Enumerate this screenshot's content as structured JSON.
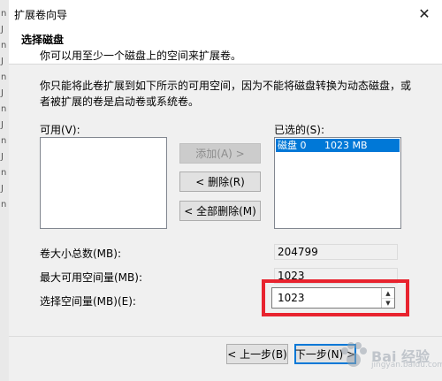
{
  "window": {
    "title": "扩展卷向导",
    "close_glyph": "✕"
  },
  "header": {
    "title": "选择磁盘",
    "subtitle": "你可以用至少一个磁盘上的空间来扩展卷。"
  },
  "description": "你只能将此卷扩展到如下所示的可用空间，因为不能将磁盘转换为动态磁盘，或者被扩展的卷是启动卷或系统卷。",
  "available": {
    "label": "可用(V):",
    "items": []
  },
  "selected": {
    "label": "已选的(S):",
    "items": [
      {
        "disk": "磁盘 0",
        "size": "1023 MB"
      }
    ]
  },
  "buttons": {
    "add": "添加(A) >",
    "remove": "< 删除(R)",
    "remove_all": "< 全部删除(M)",
    "back": "< 上一步(B)",
    "next": "下一步(N) >"
  },
  "fields": {
    "total_label": "卷大小总数(MB):",
    "total_value": "204799",
    "max_label": "最大可用空间量(MB):",
    "max_value": "1023",
    "amount_label": "选择空间量(MB)(E):",
    "amount_value": "1023"
  },
  "background": {
    "left_edge_glyphs": [
      "n",
      "J",
      "n",
      "J",
      "n",
      "J",
      "n",
      "J",
      "n",
      "J",
      "n",
      "J",
      "n"
    ]
  },
  "watermark": {
    "text": "Bai 经验",
    "sub": "jingyan.baidu.com"
  },
  "colors": {
    "highlight": "#e8232e",
    "selection": "#0078d7"
  }
}
